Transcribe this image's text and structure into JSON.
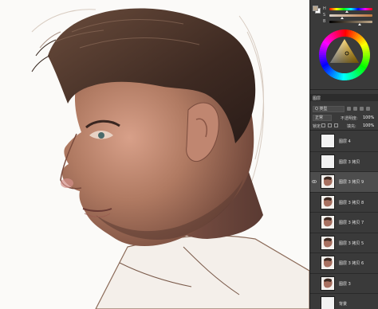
{
  "app": {
    "accent_color": "#3a3a3a"
  },
  "color_panel": {
    "foreground_color": "#b8a58c",
    "background_color": "#ffffff",
    "sliders": [
      {
        "letter": "H",
        "track": "hue"
      },
      {
        "letter": "S",
        "track": "saturation"
      },
      {
        "letter": "B",
        "track": "brightness"
      }
    ],
    "wheel": "hue-triangle color wheel"
  },
  "layers_panel": {
    "tab_label": "图层",
    "kind_label": "Q 类型",
    "blend_mode": "正常",
    "opacity_label": "不透明度:",
    "opacity_value": "100%",
    "lock_label": "锁定:",
    "fill_label": "填充:",
    "fill_value": "100%",
    "layers": [
      {
        "name": "图层 4",
        "thumb": "blank",
        "visible": false,
        "active": false
      },
      {
        "name": "图层 3 拷贝",
        "thumb": "blank",
        "visible": false,
        "active": false
      },
      {
        "name": "图层 3 拷贝 9",
        "thumb": "portrait",
        "visible": true,
        "active": true
      },
      {
        "name": "图层 3 拷贝 8",
        "thumb": "portrait",
        "visible": false,
        "active": false
      },
      {
        "name": "图层 3 拷贝 7",
        "thumb": "portrait",
        "visible": false,
        "active": false
      },
      {
        "name": "图层 3 拷贝 5",
        "thumb": "portrait",
        "visible": false,
        "active": false
      },
      {
        "name": "图层 3 拷贝 6",
        "thumb": "portrait",
        "visible": false,
        "active": false
      },
      {
        "name": "图层 3",
        "thumb": "portrait",
        "visible": false,
        "active": false
      },
      {
        "name": "背景",
        "thumb": "blank",
        "visible": false,
        "active": false
      }
    ]
  },
  "canvas": {
    "subject": "painted portrait of a man in profile",
    "hair_color": "#4a3428",
    "skin_color": "#b07a62",
    "shadow_color": "#5a3a32"
  }
}
